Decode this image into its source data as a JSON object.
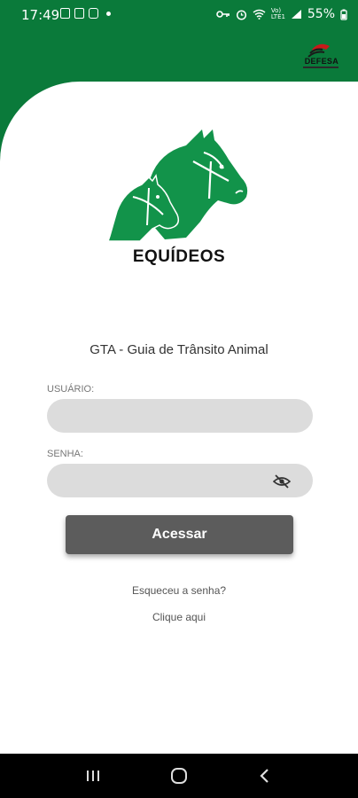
{
  "status_bar": {
    "time": "17:49",
    "battery": "55%",
    "network": "Vo) LTE1",
    "left_icons": [
      "image-icon",
      "mail-icon",
      "teams-icon",
      "dot-icon"
    ],
    "right_icons": [
      "key-icon",
      "alarm-icon",
      "wifi-icon",
      "signal-icon",
      "battery-icon"
    ]
  },
  "header": {
    "brand_name": "DEFESA",
    "logo_icon": "defesa-logo-icon"
  },
  "app": {
    "title": "EQUÍDEOS",
    "subtitle": "GTA - Guia de Trânsito Animal",
    "illustration": "horse-heads-icon"
  },
  "login": {
    "username_label": "USUÁRIO:",
    "username_value": "",
    "password_label": "SENHA:",
    "password_value": "",
    "submit_label": "Acessar",
    "forgot_text": "Esqueceu a senha?",
    "click_here": "Clique aqui"
  },
  "nav": {
    "recents": "recents-icon",
    "home": "home-icon",
    "back": "back-icon"
  },
  "colors": {
    "primary_green": "#0a7a3a",
    "horse_green": "#12934a",
    "field_bg": "#dcdcdc",
    "button_bg": "#5c5c5c"
  }
}
